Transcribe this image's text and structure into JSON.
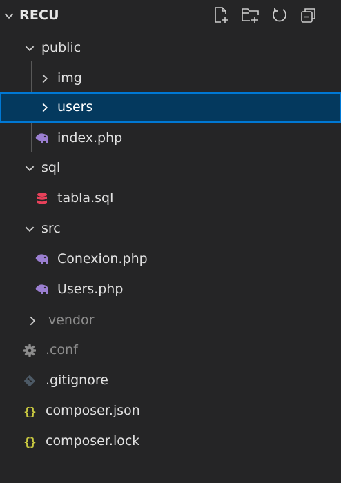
{
  "explorer": {
    "title": "RECU",
    "header_actions": [
      {
        "icon": "new-file-icon"
      },
      {
        "icon": "new-folder-icon"
      },
      {
        "icon": "refresh-icon"
      },
      {
        "icon": "collapse-all-icon"
      }
    ],
    "tree": {
      "public": {
        "label": "public",
        "children": {
          "img": {
            "label": "img"
          },
          "users": {
            "label": "users",
            "selected": true
          },
          "index": {
            "label": "index.php",
            "icon": "php-elephant-icon"
          }
        }
      },
      "sql": {
        "label": "sql",
        "children": {
          "tabla": {
            "label": "tabla.sql",
            "icon": "database-icon"
          }
        }
      },
      "src": {
        "label": "src",
        "children": {
          "conexion": {
            "label": "Conexion.php",
            "icon": "php-elephant-icon"
          },
          "users": {
            "label": "Users.php",
            "icon": "php-elephant-icon"
          }
        }
      },
      "vendor": {
        "label": "vendor"
      },
      "conf": {
        "label": ".conf",
        "icon": "gear-icon"
      },
      "gitignore": {
        "label": ".gitignore",
        "icon": "git-icon"
      },
      "composer_json": {
        "label": "composer.json",
        "icon": "json-icon"
      },
      "composer_lock": {
        "label": "composer.lock",
        "icon": "json-icon"
      }
    },
    "colors": {
      "background": "#252526",
      "selection_bg": "#04395e",
      "selection_border": "#0078d4",
      "php_icon": "#9b7fd1",
      "sql_icon": "#e8415a",
      "json_icon": "#cbcb41",
      "dim_text": "#8c8c8c"
    }
  }
}
